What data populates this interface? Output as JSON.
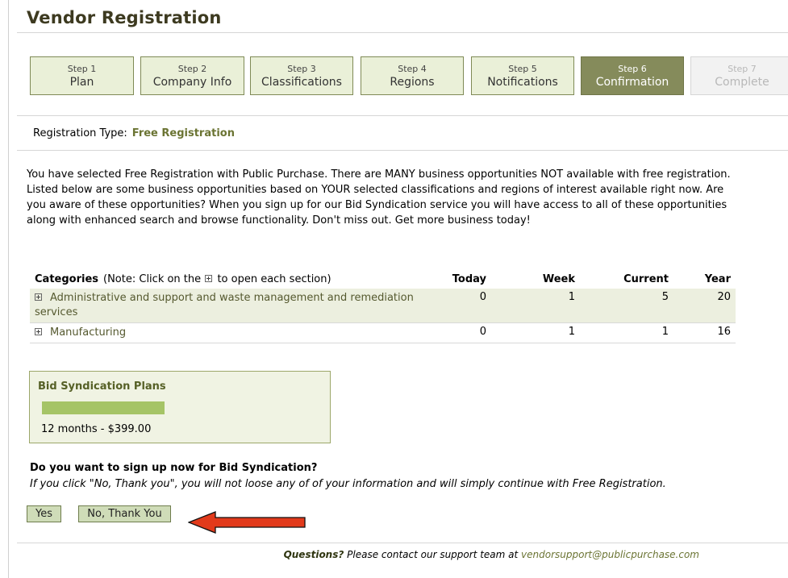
{
  "page_title": "Vendor Registration",
  "steps": [
    {
      "num": "Step 1",
      "label": "Plan",
      "state": "done"
    },
    {
      "num": "Step 2",
      "label": "Company Info",
      "state": "done"
    },
    {
      "num": "Step 3",
      "label": "Classifications",
      "state": "done"
    },
    {
      "num": "Step 4",
      "label": "Regions",
      "state": "done"
    },
    {
      "num": "Step 5",
      "label": "Notifications",
      "state": "done"
    },
    {
      "num": "Step 6",
      "label": "Confirmation",
      "state": "active"
    },
    {
      "num": "Step 7",
      "label": "Complete",
      "state": "disabled"
    }
  ],
  "registration": {
    "label": "Registration Type:",
    "value": "Free Registration"
  },
  "intro_text": "You have selected Free Registration with Public Purchase. There are MANY business opportunities NOT available with free registration. Listed below are some business opportunities based on YOUR selected classifications and regions of interest available right now. Are you aware of these opportunities? When you sign up for our Bid Syndication service you will have access to all of these opportunities along with enhanced search and browse functionality. Don't miss out. Get more business today!",
  "categories_table": {
    "header_label": "Categories",
    "note_prefix": "(Note: Click on the",
    "note_suffix": "to open each section)",
    "columns": [
      "Today",
      "Week",
      "Current",
      "Year"
    ],
    "rows": [
      {
        "name": "Administrative and support and waste management and remediation services",
        "today": "0",
        "week": "1",
        "current": "5",
        "year": "20"
      },
      {
        "name": "Manufacturing",
        "today": "0",
        "week": "1",
        "current": "1",
        "year": "16"
      }
    ]
  },
  "plans": {
    "header": "Bid Syndication Plans",
    "option": "12 months - $399.00"
  },
  "question": "Do you want to sign up now for Bid Syndication?",
  "question_note": "If you click \"No, Thank you\", you will not loose any of of your information and will simply continue with Free Registration.",
  "buttons": {
    "yes": "Yes",
    "no": "No, Thank You"
  },
  "footer": {
    "bold": "Questions?",
    "text": "Please contact our support team at",
    "email": "vendorsupport@publicpurchase.com"
  },
  "colors": {
    "active_step": "#858b5b",
    "step_bg": "#eaf0d8",
    "accent_text": "#6b7433",
    "plan_bar": "#a5c466",
    "arrow": "#e23a1b"
  }
}
